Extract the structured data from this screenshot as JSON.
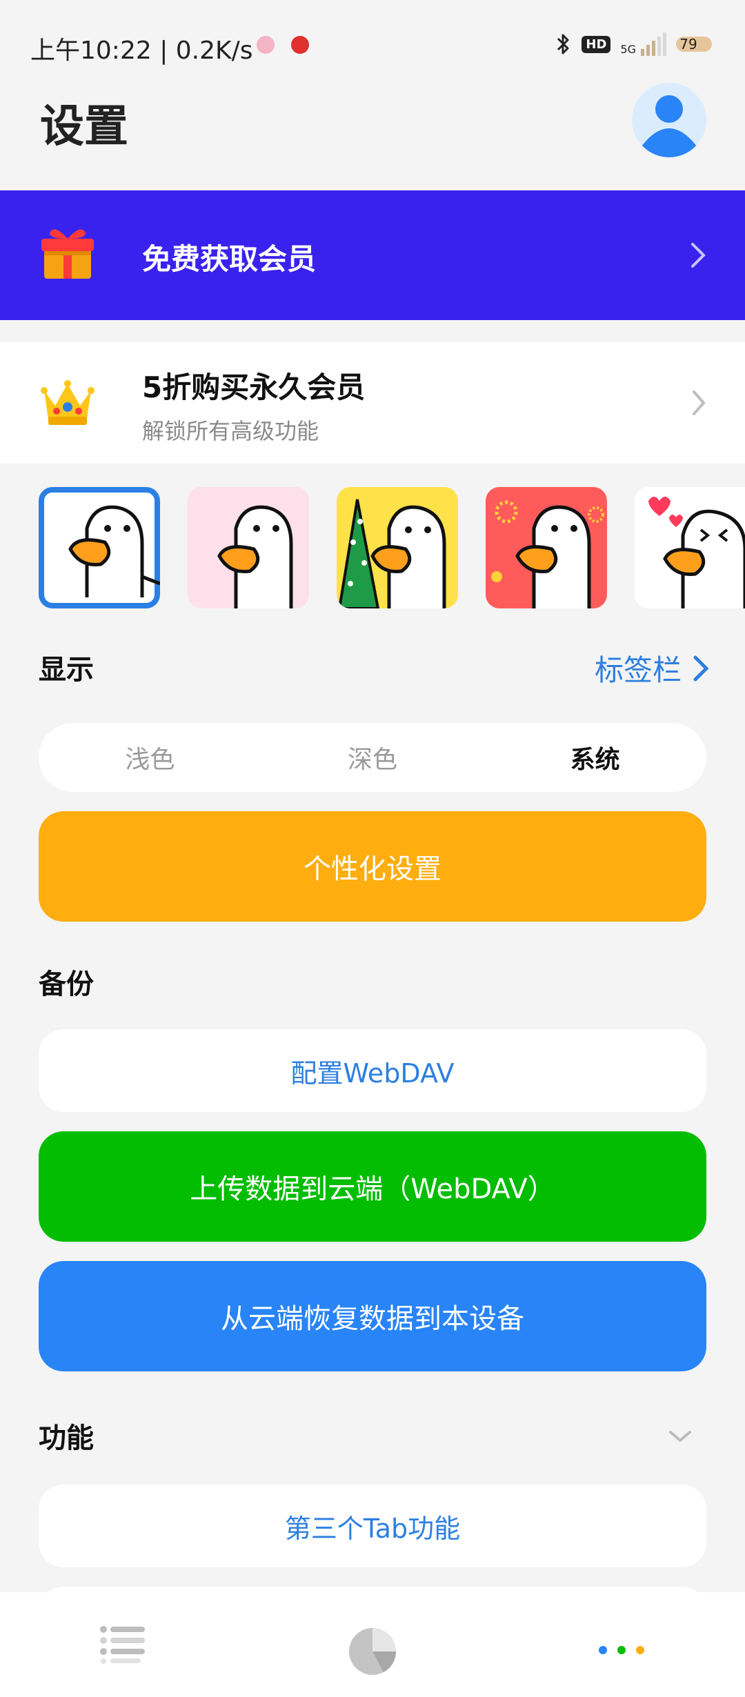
{
  "status_bar": {
    "time": "上午10:22",
    "speed": "0.2K/s",
    "hd": "HD",
    "network": "5G",
    "battery": "79"
  },
  "header": {
    "title": "设置",
    "avatar_icon": "user-avatar-icon"
  },
  "promo": {
    "label": "免费获取会员",
    "icon": "gift-icon",
    "bg_color": "#3a22ee"
  },
  "vip": {
    "title": "5折购买永久会员",
    "subtitle": "解锁所有高级功能",
    "icon": "crown-icon"
  },
  "themes": {
    "selected_index": 0,
    "items": [
      {
        "name": "white",
        "bg": "#ffffff"
      },
      {
        "name": "pink",
        "bg": "#fde0ea"
      },
      {
        "name": "christmas",
        "bg": "#ffe24a"
      },
      {
        "name": "festive-red",
        "bg": "#ff5b5b"
      },
      {
        "name": "hearts",
        "bg": "#ffffff"
      }
    ]
  },
  "display": {
    "section_title": "显示",
    "tabbar_link": "标签栏",
    "modes": [
      "浅色",
      "深色",
      "系统"
    ],
    "active_mode_index": 2,
    "personalize_button": "个性化设置"
  },
  "backup": {
    "section_title": "备份",
    "config_webdav": "配置WebDAV",
    "upload": "上传数据到云端（WebDAV）",
    "restore": "从云端恢复数据到本设备"
  },
  "features": {
    "section_title": "功能",
    "third_tab": "第三个Tab功能"
  },
  "colors": {
    "accent_blue": "#2d7fe0",
    "orange": "#ffad0f",
    "green": "#03bd03",
    "blue": "#2884f7"
  }
}
